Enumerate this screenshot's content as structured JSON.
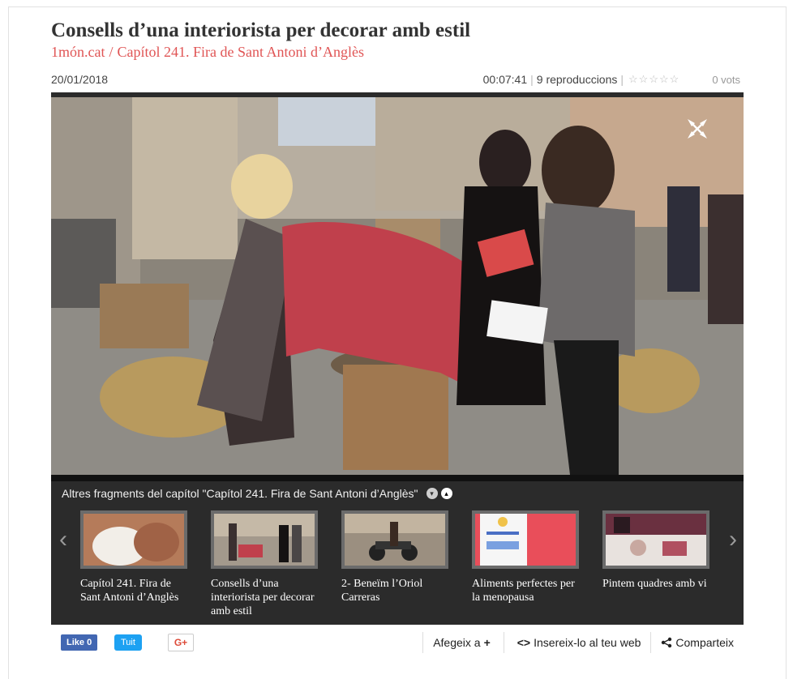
{
  "header": {
    "title": "Consells d’una interiorista per decorar amb estil",
    "breadcrumb": [
      "1món.cat",
      "Capítol 241. Fira de Sant Antoni d’Anglès"
    ],
    "separator": "/"
  },
  "meta": {
    "date": "20/01/2018",
    "duration": "00:07:41",
    "plays": "9 reproduccions",
    "pipe": "|",
    "stars": "☆☆☆☆☆",
    "votes": "0 vots"
  },
  "player": {
    "expand_icon": "expand-icon",
    "fragments_heading": "Altres fragments del capítol \"Capítol 241. Fira de Sant Antoni d’Anglès\"",
    "collapse_glyph": "▾",
    "expand_glyph": "▴",
    "prev_glyph": "‹",
    "next_glyph": "›",
    "thumbnails": [
      {
        "caption": "Capítol 241. Fira de Sant Antoni d’Anglès"
      },
      {
        "caption": "Consells d’una interiorista per decorar amb estil"
      },
      {
        "caption": "2- Beneïm l’Oriol Carreras"
      },
      {
        "caption": "Aliments perfectes per la menopausa"
      },
      {
        "caption": "Pintem quadres amb vi"
      }
    ]
  },
  "footer": {
    "like_label": "Like 0",
    "tweet_label": "Tuit",
    "gplus_label": "G+",
    "add_to_label": "Afegeix a",
    "add_icon": "+",
    "embed_icon": "<>",
    "embed_label": "Insereix-lo al teu web",
    "share_icon": "share-icon",
    "share_label": "Comparteix"
  },
  "colors": {
    "accent": "#e05555",
    "facebook": "#4267b2",
    "twitter": "#1da1f2",
    "player_bg": "#2b2b2b"
  }
}
